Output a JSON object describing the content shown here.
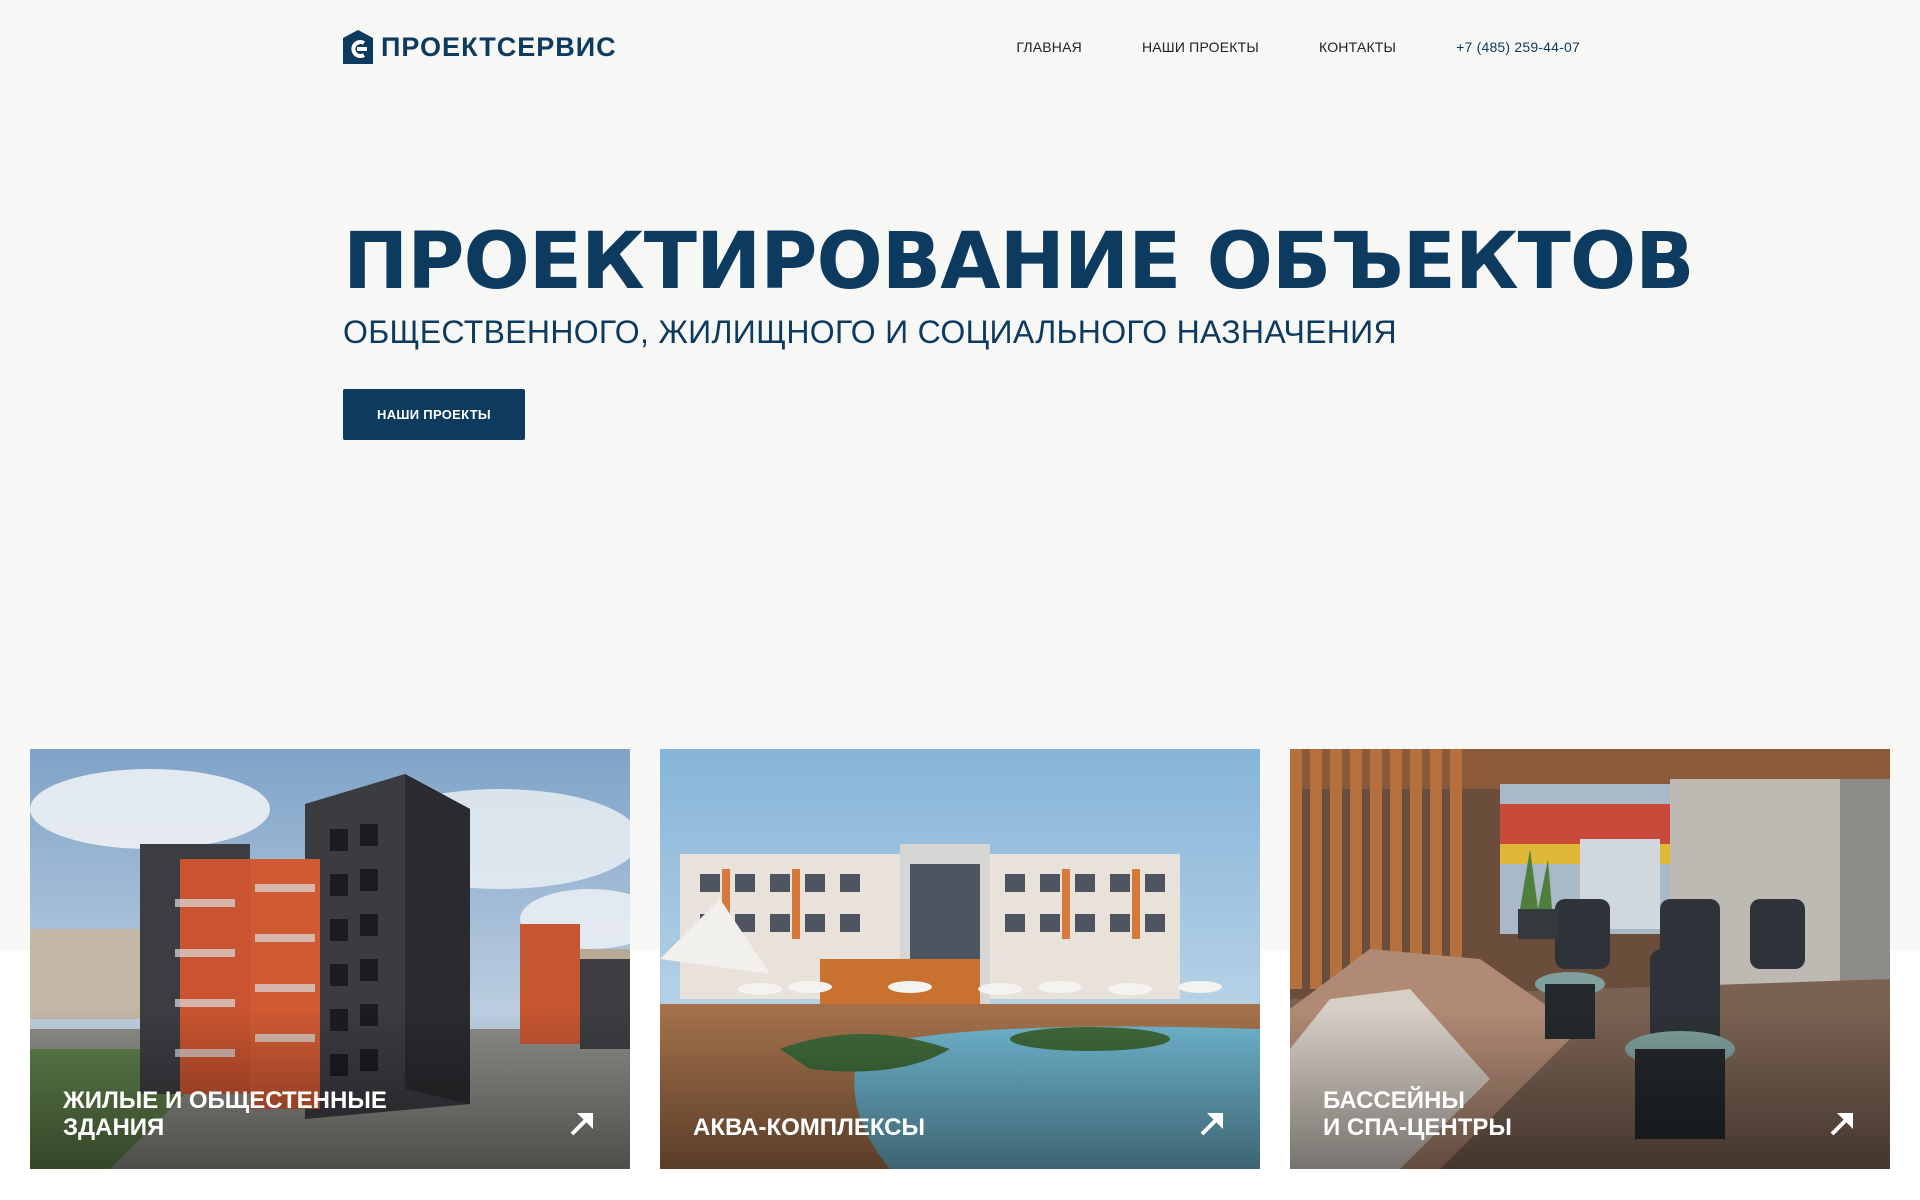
{
  "header": {
    "logo_text": "ПРОЕКТСЕРВИС",
    "nav": [
      {
        "label": "ГЛАВНАЯ"
      },
      {
        "label": "НАШИ ПРОЕКТЫ"
      },
      {
        "label": "КОНТАКТЫ"
      }
    ],
    "phone": "+7 (485) 259-44-07"
  },
  "hero": {
    "title": "ПРОЕКТИРОВАНИЕ ОБЪЕКТОВ",
    "subtitle": "ОБЩЕСТВЕННОГО, ЖИЛИЩНОГО И СОЦИАЛЬНОГО НАЗНАЧЕНИЯ",
    "button_label": "НАШИ ПРОЕКТЫ"
  },
  "cards": [
    {
      "line1": "ЖИЛЫЕ И ОБЩЕСТЕННЫЕ",
      "line2": "ЗДАНИЯ",
      "icon": "arrow-up-right-icon"
    },
    {
      "line1": "АКВА-КОМПЛЕКСЫ",
      "line2": "",
      "icon": "arrow-up-right-icon"
    },
    {
      "line1": "БАССЕЙНЫ",
      "line2": "И СПА-ЦЕНТРЫ",
      "icon": "arrow-up-right-icon"
    }
  ],
  "colors": {
    "brand": "#0d3a5f",
    "page_background": "#f7f7f5",
    "card_text": "#ffffff"
  }
}
